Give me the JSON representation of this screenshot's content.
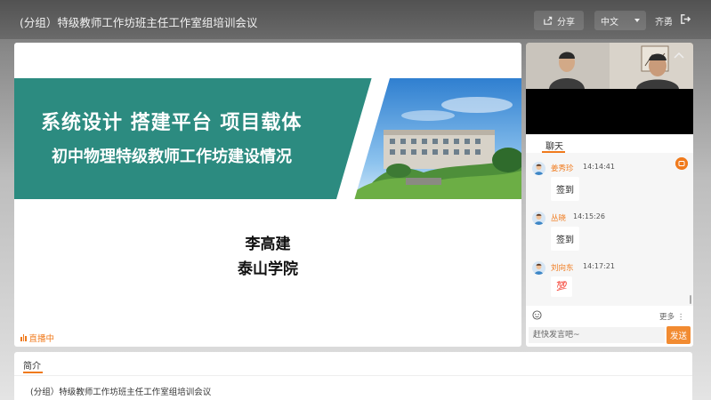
{
  "header": {
    "title": "(分组）特级教师工作坊班主任工作室组培训会议",
    "share_label": "分享",
    "language": "中文",
    "user_name": "齐勇"
  },
  "slide": {
    "title": "系统设计 搭建平台 项目载体",
    "subtitle": "初中物理特级教师工作坊建设情况",
    "presenter_name": "李高建",
    "presenter_org": "泰山学院",
    "live_label": "直播中"
  },
  "chat": {
    "tab_label": "聊天",
    "messages": [
      {
        "name": "姜秀珍",
        "time": "14:14:41",
        "text": "签到"
      },
      {
        "name": "丛晓",
        "time": "14:15:26",
        "text": "签到"
      },
      {
        "name": "刘向东",
        "time": "14:17:21",
        "text": "💯"
      }
    ],
    "more_label": "更多",
    "input_placeholder": "赶快发言吧~",
    "send_label": "发送"
  },
  "intro": {
    "tab_label": "简介",
    "text": "(分组）特级教师工作坊班主任工作室组培训会议"
  },
  "colors": {
    "accent": "#f07a1c",
    "slide_green": "#2c8b80",
    "send_button": "#f28b31"
  }
}
